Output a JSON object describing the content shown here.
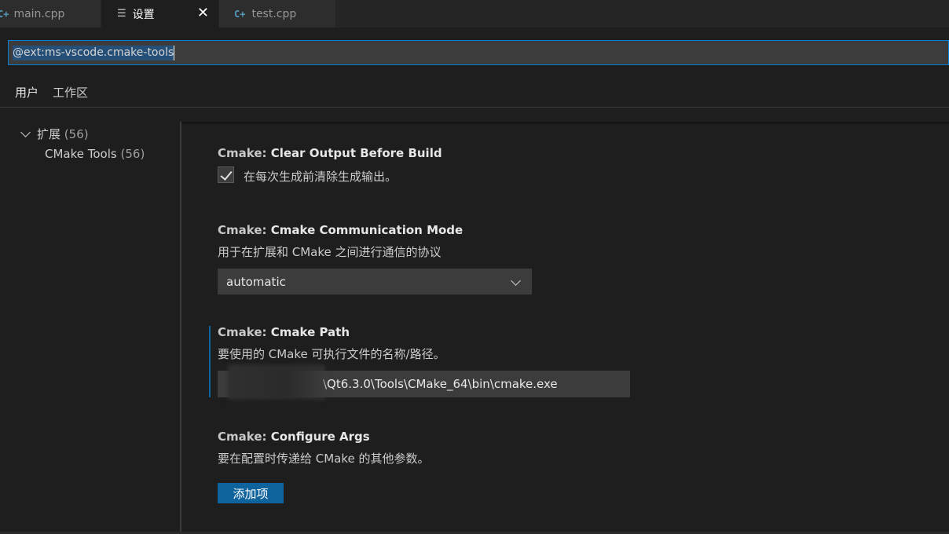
{
  "tabs": [
    {
      "label": "main.cpp",
      "icon": "cpp-file-icon"
    },
    {
      "label": "设置",
      "icon": "settings-file-icon",
      "close": "✕"
    },
    {
      "label": "test.cpp",
      "icon": "cpp-file-icon"
    }
  ],
  "search": {
    "value": "@ext:ms-vscode.cmake-tools"
  },
  "scope_tabs": [
    "用户",
    "工作区"
  ],
  "toc": {
    "extensions_label": "扩展",
    "extensions_count": "(56)",
    "cmake_label": "CMake Tools",
    "cmake_count": "(56)"
  },
  "settings": {
    "clear_output": {
      "category": "Cmake: ",
      "name": "Clear Output Before Build",
      "checkbox_label": "在每次生成前清除生成输出。",
      "checked": true
    },
    "comm_mode": {
      "category": "Cmake: ",
      "name": "Cmake Communication Mode",
      "description": "用于在扩展和 CMake 之间进行通信的协议",
      "selected": "automatic"
    },
    "cmake_path": {
      "category": "Cmake: ",
      "name": "Cmake Path",
      "description": "要使用的 CMake 可执行文件的名称/路径。",
      "value": "\\Qt6.3.0\\Tools\\CMake_64\\bin\\cmake.exe"
    },
    "configure_args": {
      "category": "Cmake: ",
      "name": "Configure Args",
      "description": "要在配置时传递给 CMake 的其他参数。",
      "add_button": "添加项"
    }
  },
  "colors": {
    "accent": "#007fd4",
    "button": "#0e639c",
    "background": "#1e1e1e"
  }
}
